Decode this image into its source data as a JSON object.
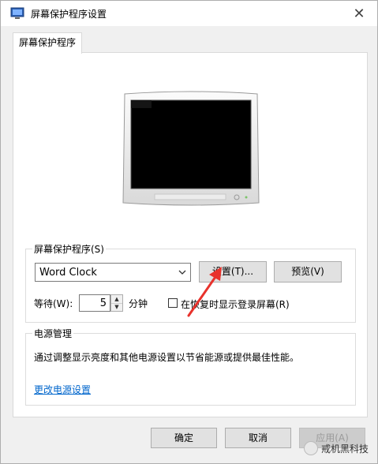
{
  "window": {
    "title": "屏幕保护程序设置",
    "close_symbol": "✕"
  },
  "tab": {
    "label": "屏幕保护程序"
  },
  "screensaver": {
    "group_label": "屏幕保护程序(S)",
    "selected": "Word Clock",
    "settings_button": "设置(T)...",
    "preview_button": "预览(V)",
    "wait_label": "等待(W):",
    "wait_value": "5",
    "wait_unit": "分钟",
    "resume_checkbox_label": "在恢复时显示登录屏幕(R)",
    "resume_checked": false
  },
  "power": {
    "group_label": "电源管理",
    "description": "通过调整显示亮度和其他电源设置以节省能源或提供最佳性能。",
    "link": "更改电源设置"
  },
  "footer": {
    "ok": "确定",
    "cancel": "取消",
    "apply": "应用(A)"
  },
  "watermark": {
    "text": "戒机黑科技"
  },
  "colors": {
    "arrow": "#e8322c",
    "link": "#0066cc",
    "apply_disabled_text": "#9a9a9a"
  },
  "icons": [
    "screensaver-app-icon",
    "close-icon",
    "monitor-icon",
    "dropdown-arrow-icon",
    "spin-up-icon",
    "spin-down-icon",
    "red-arrow-annotation",
    "watermark-icon"
  ]
}
